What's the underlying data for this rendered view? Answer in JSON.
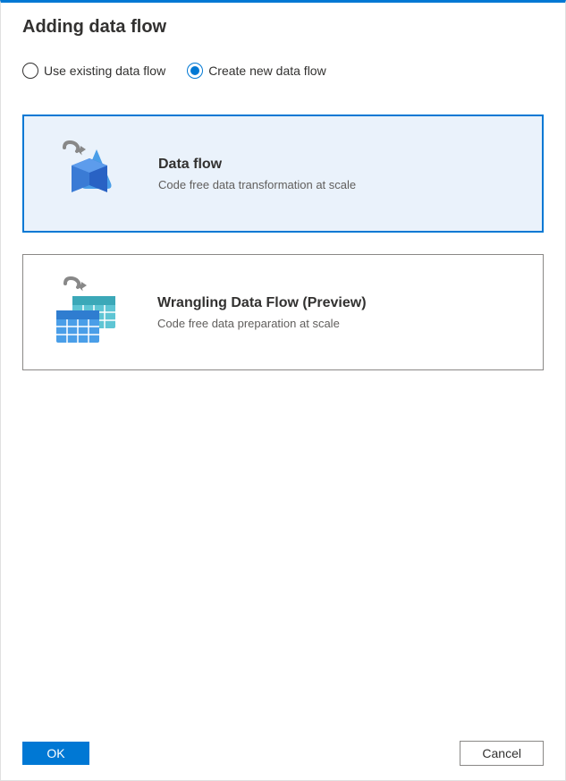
{
  "title": "Adding data flow",
  "radioOptions": {
    "existing": "Use existing data flow",
    "create": "Create new data flow"
  },
  "cards": {
    "dataFlow": {
      "title": "Data flow",
      "description": "Code free data transformation at scale"
    },
    "wrangling": {
      "title": "Wrangling Data Flow (Preview)",
      "description": "Code free data preparation at scale"
    }
  },
  "buttons": {
    "ok": "OK",
    "cancel": "Cancel"
  }
}
